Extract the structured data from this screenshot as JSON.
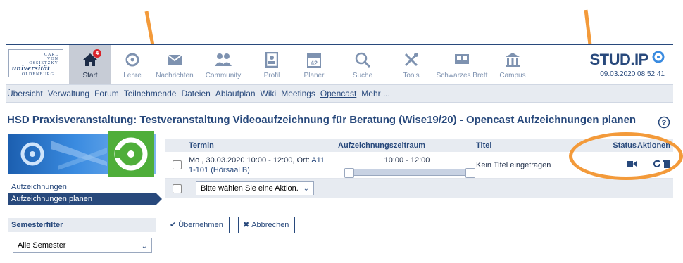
{
  "logo": {
    "line1": "CARL\nVON\nOSSIETZKY",
    "line2": "universität",
    "line3": "OLDENBURG"
  },
  "nav": [
    {
      "label": "Start",
      "icon": "home-icon",
      "active": true,
      "badge": "4"
    },
    {
      "label": "Lehre",
      "icon": "seminar-icon"
    },
    {
      "label": "Nachrichten",
      "icon": "mail-icon"
    },
    {
      "label": "Community",
      "icon": "community-icon"
    },
    {
      "label": "Profil",
      "icon": "profile-icon"
    },
    {
      "label": "Planer",
      "icon": "calendar-icon",
      "extra": "42"
    },
    {
      "label": "Suche",
      "icon": "search-icon"
    },
    {
      "label": "Tools",
      "icon": "tools-icon"
    },
    {
      "label": "Schwarzes Brett",
      "icon": "board-icon"
    },
    {
      "label": "Campus",
      "icon": "campus-icon"
    }
  ],
  "brand": {
    "name": "STUD.IP",
    "time": "09.03.2020 08:52:41"
  },
  "subnav": [
    "Übersicht",
    "Verwaltung",
    "Forum",
    "Teilnehmende",
    "Dateien",
    "Ablaufplan",
    "Wiki",
    "Meetings",
    "Opencast",
    "Mehr ..."
  ],
  "subnav_current": "Opencast",
  "page": {
    "title": "HSD Praxisveranstaltung: Testveranstaltung Videoaufzeichnung für Beratung (Wise19/20) - Opencast Aufzeichnungen planen"
  },
  "sidebar": {
    "items": [
      "Aufzeichnungen",
      "Aufzeichnungen planen"
    ],
    "semester_header": "Semesterfilter",
    "semester_value": "Alle Semester"
  },
  "table": {
    "headers": {
      "termin": "Termin",
      "zeitraum": "Aufzeichnungszeitraum",
      "titel": "Titel",
      "status": "Status",
      "aktionen": "Aktionen"
    },
    "row": {
      "termin_line1": "Mo , 30.03.2020 10:00 - 12:00, Ort: ",
      "ort_link1": "A11",
      "ort_link2": "1-101 (Hörsaal B)",
      "zeitraum": "10:00 - 12:00",
      "titel": "Kein Titel eingetragen"
    },
    "action_select": "Bitte wählen Sie eine Aktion."
  },
  "buttons": {
    "apply": "Übernehmen",
    "cancel": "Abbrechen"
  },
  "colors": {
    "primary": "#28497c",
    "annotation": "#f39a3a",
    "opencast_green": "#4fae3a"
  }
}
